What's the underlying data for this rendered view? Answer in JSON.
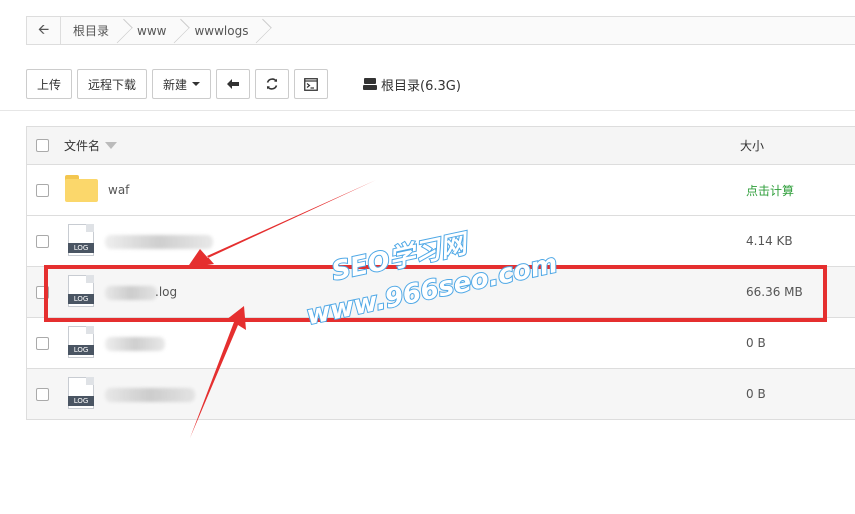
{
  "breadcrumb": {
    "back_icon": "arrow-left-icon",
    "items": [
      "根目录",
      "www",
      "wwwlogs"
    ]
  },
  "toolbar": {
    "upload_label": "上传",
    "remote_download_label": "远程下载",
    "new_label": "新建",
    "back_icon": "arrow-left-icon",
    "refresh_icon": "refresh-icon",
    "terminal_icon": "terminal-icon",
    "disk_icon": "hdd-icon",
    "disk_label": "根目录(6.3G)"
  },
  "table": {
    "col_name": "文件名",
    "col_size": "大小",
    "rows": [
      {
        "name": "waf",
        "type": "folder",
        "size": "点击计算"
      },
      {
        "name": "",
        "type": "log",
        "size": "4.14 KB"
      },
      {
        "name": ".log",
        "type": "log",
        "size": "66.36 MB"
      },
      {
        "name": "",
        "type": "log",
        "size": "0 B"
      },
      {
        "name": "",
        "type": "log",
        "size": "0 B"
      }
    ],
    "log_icon_label": "LOG"
  },
  "watermark": {
    "line1": "SEO学习网",
    "line2": "www.966seo.com"
  },
  "colors": {
    "highlight": "#e52f2f",
    "calc_link": "#2e9e3a",
    "watermark": "#4fa8e6"
  }
}
